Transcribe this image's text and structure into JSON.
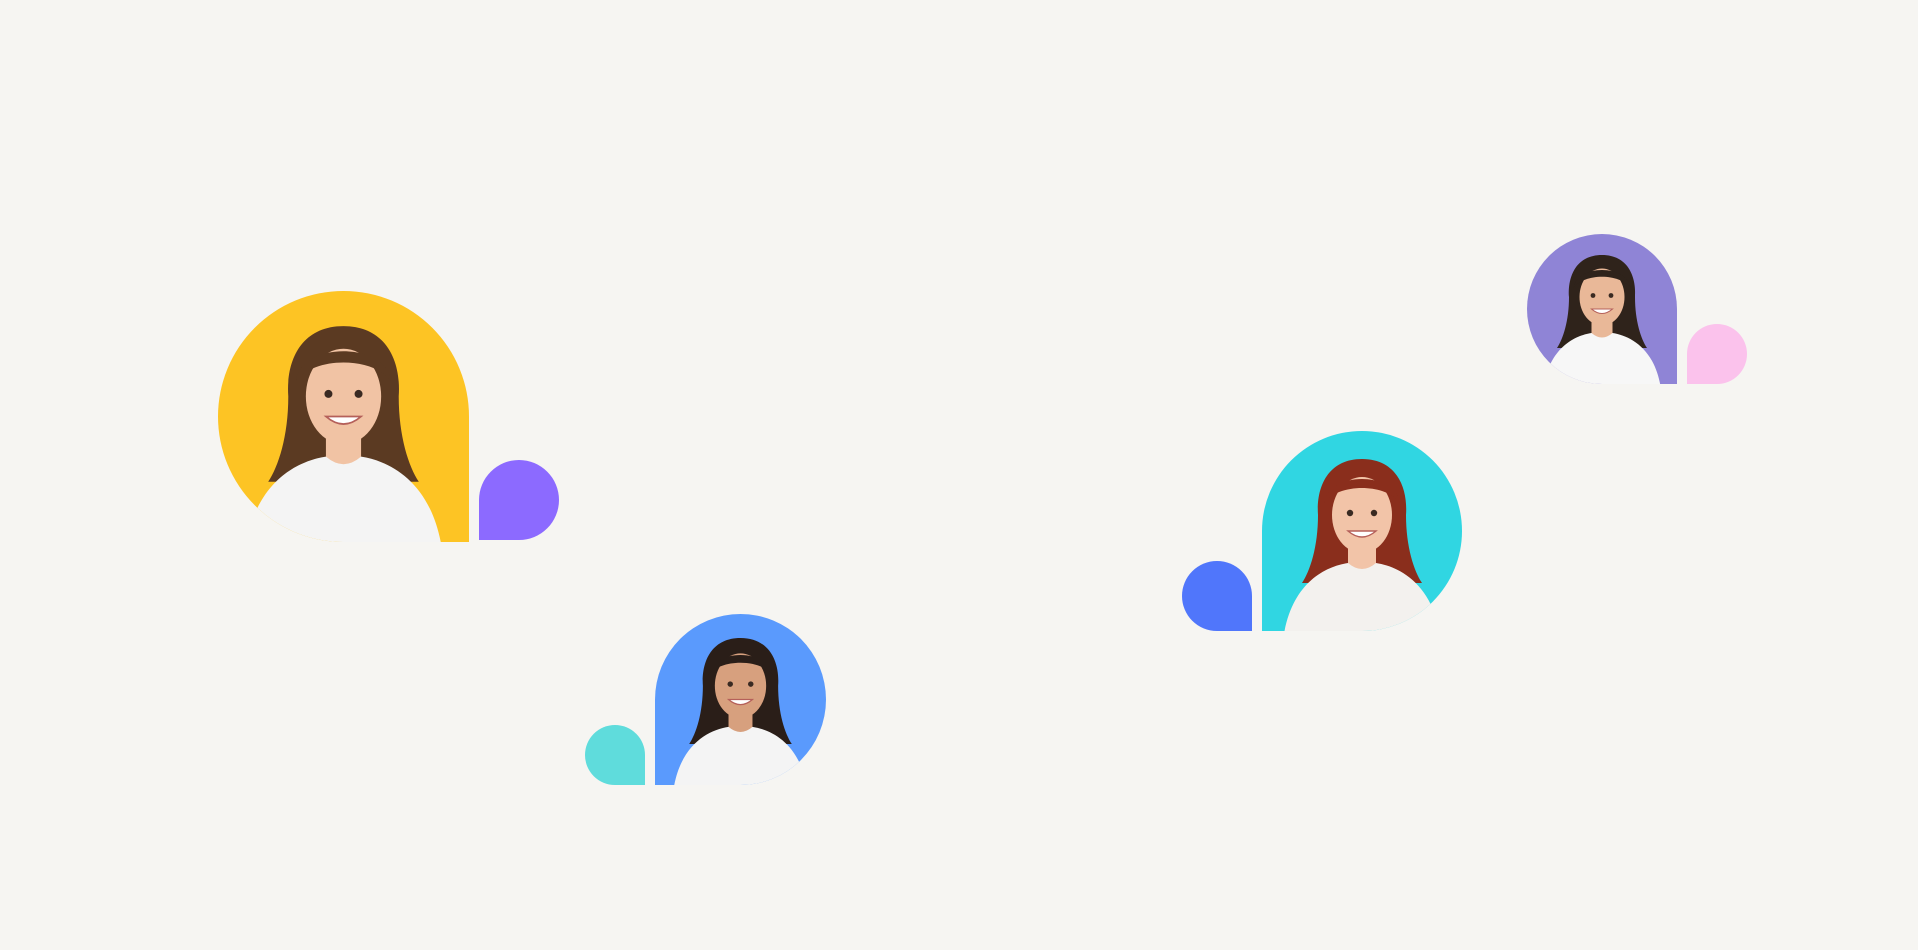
{
  "profiles": [
    {
      "id": "c1",
      "bg_color": "#fdc424",
      "accent_dot_color": "#8c6aff",
      "hair_color": "#5b3a22",
      "skin_color": "#f1c3a4",
      "shirt_color": "#f4f4f4",
      "icon": "person-portrait-icon"
    },
    {
      "id": "c2",
      "bg_color": "#5a9afd",
      "accent_dot_color": "#5fdcdc",
      "hair_color": "#2a1e18",
      "skin_color": "#d7a07e",
      "shirt_color": "#f4f4f4",
      "icon": "person-portrait-icon"
    },
    {
      "id": "c3",
      "bg_color": "#30d6e2",
      "accent_dot_color": "#5076fb",
      "hair_color": "#8a2e1c",
      "skin_color": "#f2c4a8",
      "shirt_color": "#f3f1ee",
      "icon": "person-portrait-icon"
    },
    {
      "id": "c4",
      "bg_color": "#8f84d6",
      "accent_dot_color": "#fbc2ec",
      "hair_color": "#2f231b",
      "skin_color": "#e9b898",
      "shirt_color": "#f7f7f7",
      "icon": "person-portrait-icon"
    }
  ]
}
